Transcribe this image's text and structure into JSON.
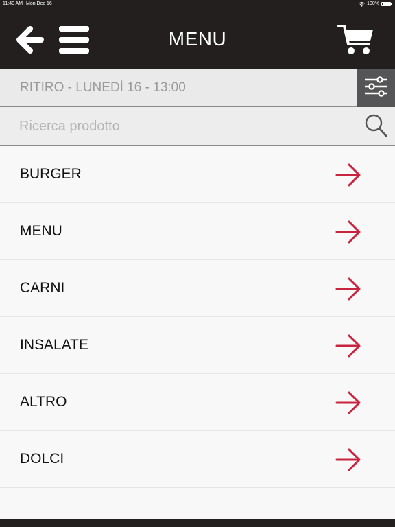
{
  "status_bar": {
    "time": "11:40 AM",
    "date": "Mon Dec 16",
    "battery": "100%",
    "icons": [
      "wifi-icon",
      "battery-icon"
    ]
  },
  "header": {
    "title": "MENU",
    "icons": [
      "back-arrow-icon",
      "hamburger-icon",
      "cart-icon"
    ]
  },
  "pickup": {
    "label": "RITIRO - LUNEDÌ 16 - 13:00",
    "filter_icon": "sliders-icon"
  },
  "search": {
    "placeholder": "Ricerca prodotto",
    "value": "",
    "icon": "search-icon"
  },
  "categories": [
    {
      "label": "BURGER"
    },
    {
      "label": "MENU"
    },
    {
      "label": "CARNI"
    },
    {
      "label": "INSALATE"
    },
    {
      "label": "ALTRO"
    },
    {
      "label": "DOLCI"
    }
  ],
  "colors": {
    "header_bg": "#231f1f",
    "accent_arrow": "#c8243f",
    "filter_bg": "#555557",
    "pickup_text": "#9a9a9a"
  }
}
